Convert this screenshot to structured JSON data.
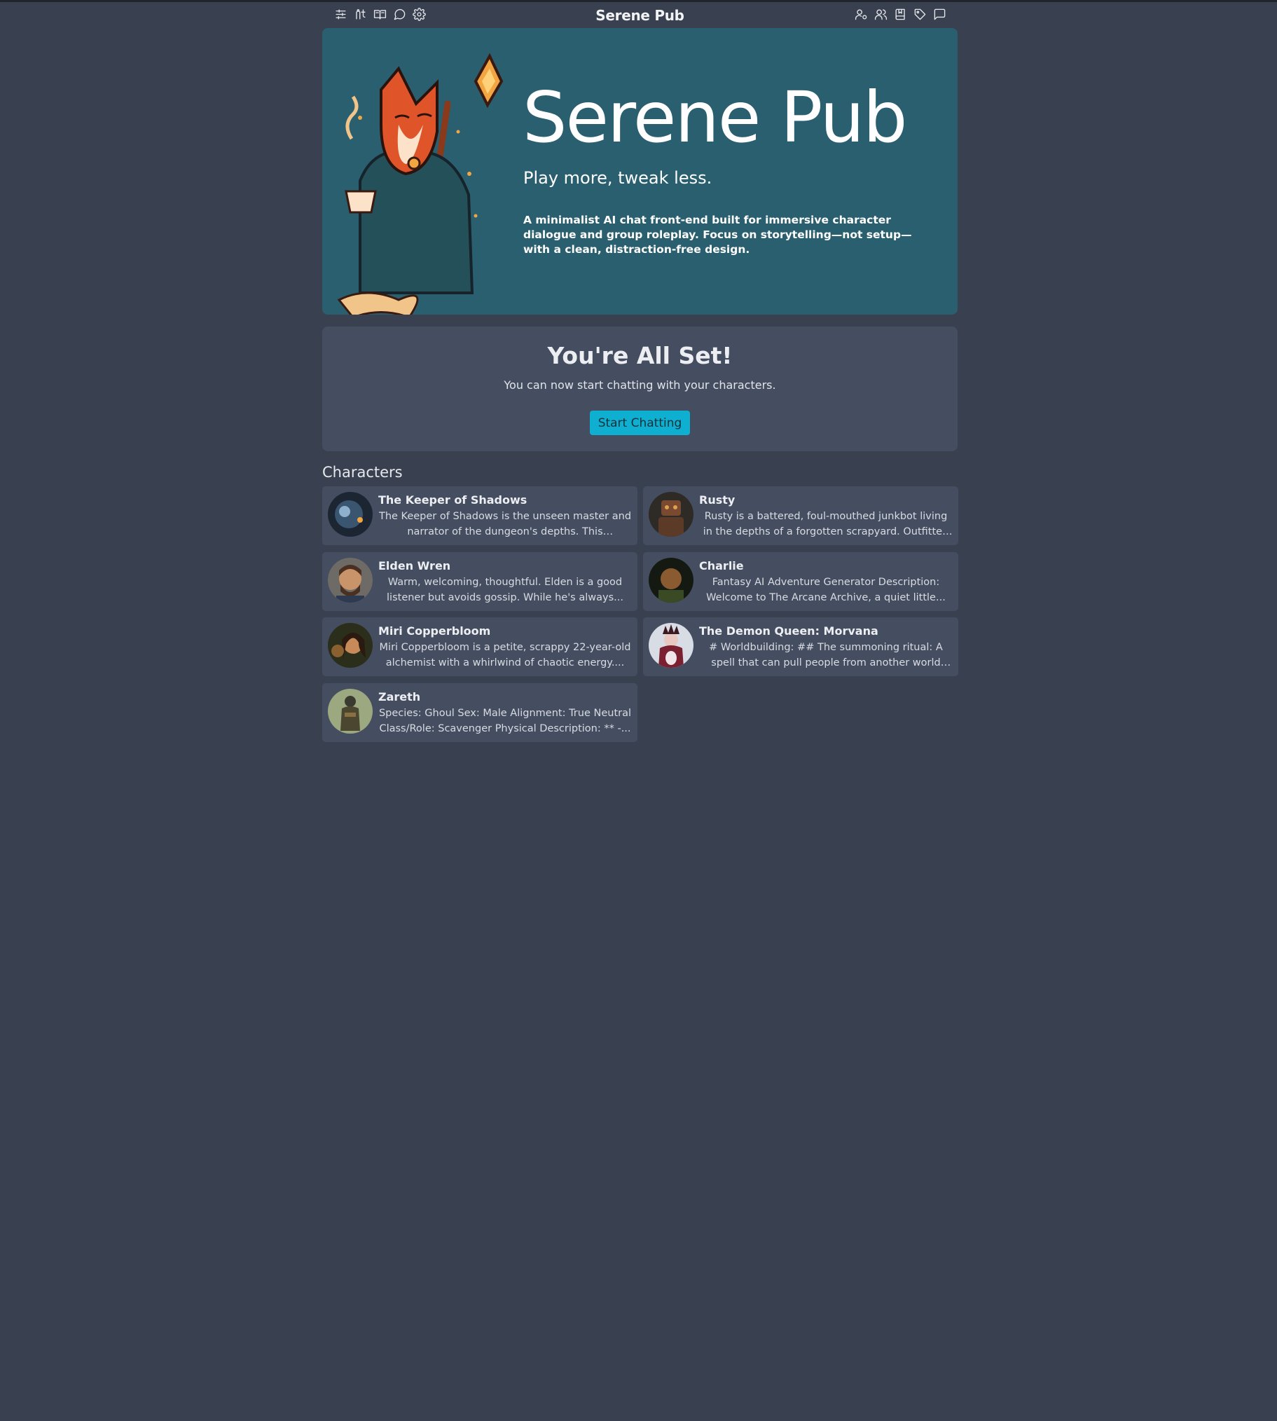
{
  "header": {
    "title": "Serene Pub",
    "left_icons": [
      "sliders-icon",
      "settings-adjust-icon",
      "book-open-icon",
      "chat-bubble-icon",
      "gear-icon"
    ],
    "right_icons": [
      "user-icon",
      "users-icon",
      "book-bookmark-icon",
      "tag-icon",
      "message-square-icon"
    ]
  },
  "hero": {
    "title": "Serene Pub",
    "subtitle": "Play more, tweak less.",
    "description": "A minimalist AI chat front-end built for immersive character dialogue and group roleplay. Focus on storytelling—not setup—with a clean, distraction-free design."
  },
  "setup": {
    "heading": "You're All Set!",
    "message": "You can now start chatting with your characters.",
    "button_label": "Start Chatting"
  },
  "characters": {
    "heading": "Characters",
    "items": [
      {
        "name": "The Keeper of Shadows",
        "description": "The Keeper of Shadows is the unseen master and narrator of the dungeon's depths. This enigmatic..."
      },
      {
        "name": "Rusty",
        "description": "Rusty is a battered, foul-mouthed junkbot living in the depths of a forgotten scrapyard. Outfitted wit..."
      },
      {
        "name": "Elden Wren",
        "description": "Warm, welcoming, thoughtful. Elden is a good listener but avoids gossip. While he's always..."
      },
      {
        "name": "Charlie",
        "description": "Fantasy AI Adventure Generator Description: Welcome to The Arcane Archive, a quiet little..."
      },
      {
        "name": "Miri Copperbloom",
        "description": "Miri Copperbloom is a petite, scrappy 22-year-old alchemist with a whirlwind of chaotic energy...."
      },
      {
        "name": "The Demon Queen: Morvana",
        "description": "# Worldbuilding: ## The summoning ritual: A spell that can pull people from another world when th..."
      },
      {
        "name": "Zareth",
        "description": "Species: Ghoul Sex: Male Alignment: True Neutral Class/Role: Scavenger Physical Description: ** -..."
      }
    ]
  },
  "colors": {
    "background": "#394150",
    "hero": "#2a5f70",
    "card": "#454e60",
    "accent": "#0eafd1"
  }
}
